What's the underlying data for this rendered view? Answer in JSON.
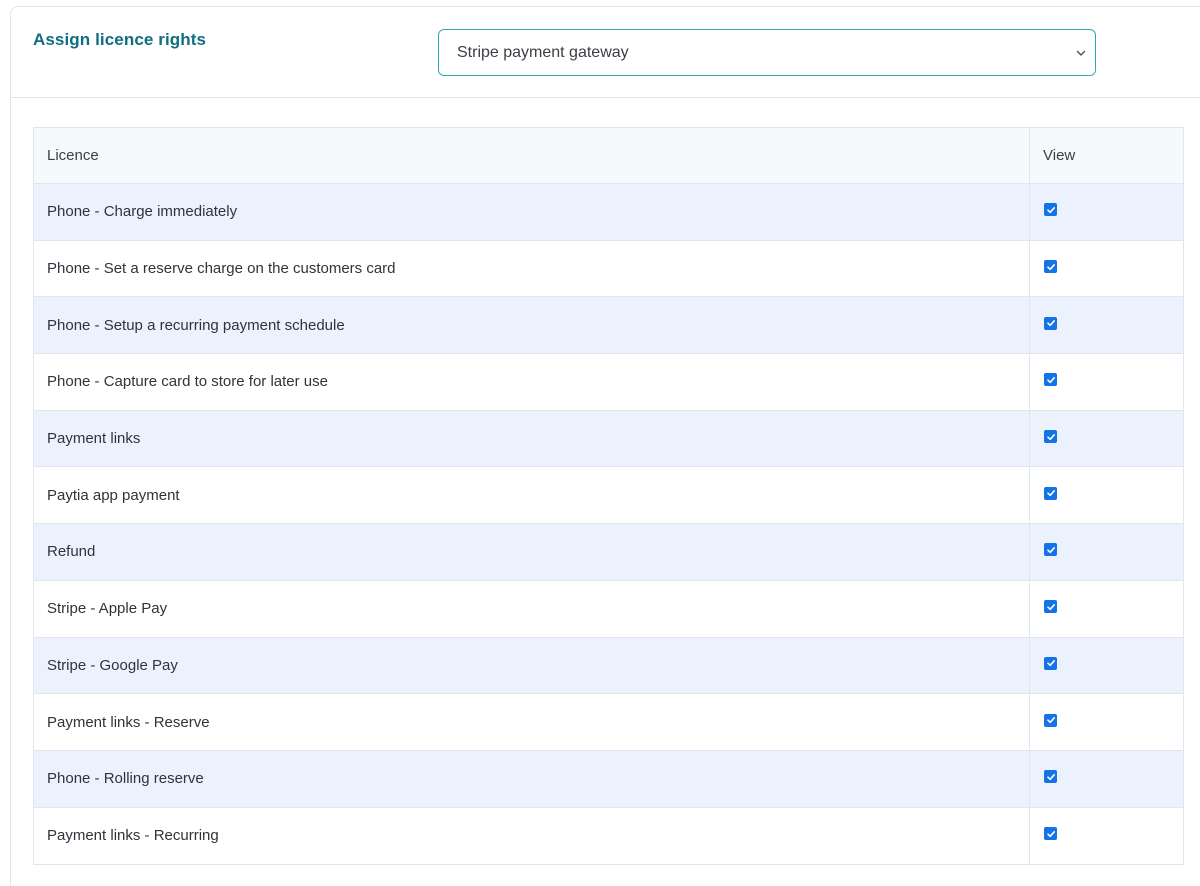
{
  "header": {
    "title": "Assign licence rights",
    "gateway_select": {
      "selected": "Stripe payment gateway",
      "icon": "chevron-down-icon"
    }
  },
  "table": {
    "columns": [
      "Licence",
      "View"
    ],
    "rows": [
      {
        "licence": "Phone - Charge immediately",
        "view": true
      },
      {
        "licence": "Phone - Set a reserve charge on the customers card",
        "view": true
      },
      {
        "licence": "Phone - Setup a recurring payment schedule",
        "view": true
      },
      {
        "licence": "Phone - Capture card to store for later use",
        "view": true
      },
      {
        "licence": "Payment links",
        "view": true
      },
      {
        "licence": "Paytia app payment",
        "view": true
      },
      {
        "licence": "Refund",
        "view": true
      },
      {
        "licence": "Stripe - Apple Pay",
        "view": true
      },
      {
        "licence": "Stripe - Google Pay",
        "view": true
      },
      {
        "licence": "Payment links - Reserve",
        "view": true
      },
      {
        "licence": "Phone - Rolling reserve",
        "view": true
      },
      {
        "licence": "Payment links - Recurring",
        "view": true
      }
    ]
  },
  "colors": {
    "accent": "#0f6e7f",
    "select_border": "#34a7b5",
    "checkbox": "#1473e6",
    "row_stripe": "#ebf2fe",
    "header_bg": "#f3fbfd"
  }
}
